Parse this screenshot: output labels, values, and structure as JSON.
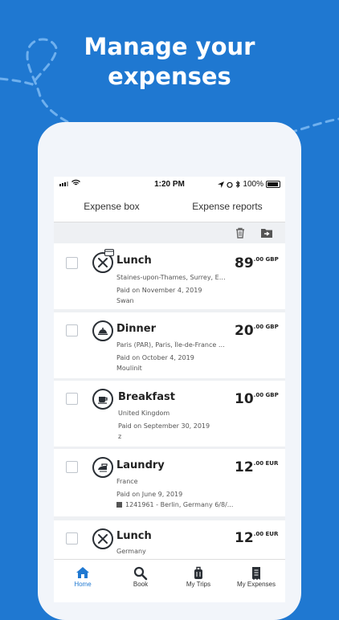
{
  "promo": {
    "headline_line1": "Manage your",
    "headline_line2": "expenses"
  },
  "colors": {
    "brand_blue": "#1f78d1",
    "dark_icon": "#2a2f35"
  },
  "statusbar": {
    "time": "1:20 PM",
    "battery": "100%"
  },
  "tabs": [
    {
      "label": "Expense box",
      "active": true
    },
    {
      "label": "Expense reports",
      "active": false
    }
  ],
  "toolbar": {
    "delete_icon": "trash-icon",
    "move_icon": "folder-move-icon"
  },
  "expenses": [
    {
      "title": "Lunch",
      "icon": "restaurant-card-icon",
      "location": "Staines-upon-Thames, Surrey, Eng...",
      "paid": "Paid on November 4, 2019",
      "sub": "Swan",
      "amount_int": "89",
      "amount_suffix": ".00 GBP"
    },
    {
      "title": "Dinner",
      "icon": "cloche-icon",
      "location": "Paris (PAR), Paris, Île-de-France Re...",
      "paid": "Paid on October 4, 2019",
      "sub": "Moulinit",
      "amount_int": "20",
      "amount_suffix": ".00 GBP"
    },
    {
      "title": "Breakfast",
      "icon": "coffee-cup-icon",
      "location": "United Kingdom",
      "paid": "Paid on September 30, 2019",
      "sub": "z",
      "amount_int": "10",
      "amount_suffix": ".00 GBP"
    },
    {
      "title": "Laundry",
      "icon": "iron-icon",
      "location": "France",
      "paid": "Paid on June 9, 2019",
      "sub": "1241961 - Berlin, Germany 6/8/...",
      "amount_int": "12",
      "amount_suffix": ".00 EUR"
    },
    {
      "title": "Lunch",
      "icon": "restaurant-icon",
      "location": "Germany",
      "paid": "",
      "sub": "",
      "amount_int": "12",
      "amount_suffix": ".00 EUR"
    }
  ],
  "bottom_nav": [
    {
      "label": "Home",
      "icon": "home-icon",
      "active": true
    },
    {
      "label": "Book",
      "icon": "search-icon",
      "active": false
    },
    {
      "label": "My Trips",
      "icon": "suitcase-icon",
      "active": false
    },
    {
      "label": "My Expenses",
      "icon": "receipt-icon",
      "active": false
    }
  ]
}
